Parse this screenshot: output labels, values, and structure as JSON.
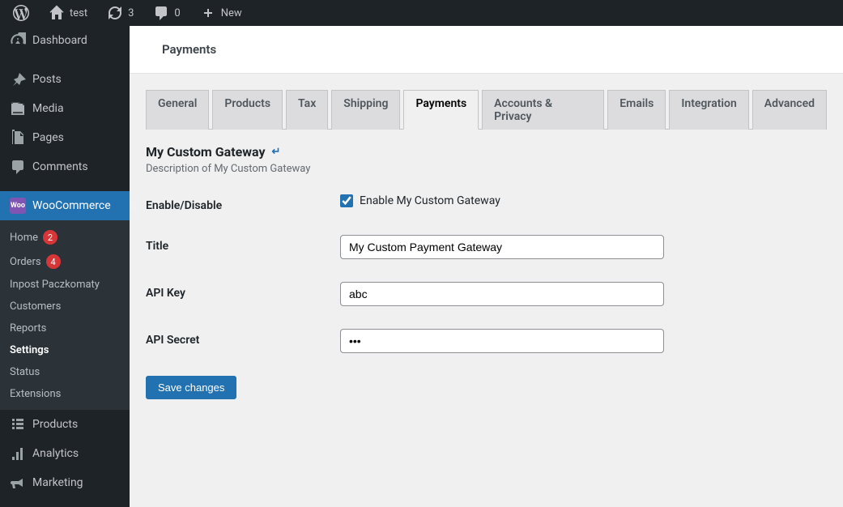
{
  "toolbar": {
    "site_name": "test",
    "updates": "3",
    "comments": "0",
    "new_label": "New"
  },
  "sidebar": {
    "items": [
      {
        "label": "Dashboard"
      },
      {
        "label": "Posts"
      },
      {
        "label": "Media"
      },
      {
        "label": "Pages"
      },
      {
        "label": "Comments"
      },
      {
        "label": "WooCommerce"
      },
      {
        "label": "Products"
      },
      {
        "label": "Analytics"
      },
      {
        "label": "Marketing"
      }
    ],
    "woo_submenu": [
      {
        "label": "Home",
        "badge": "2"
      },
      {
        "label": "Orders",
        "badge": "4"
      },
      {
        "label": "Inpost Paczkomaty"
      },
      {
        "label": "Customers"
      },
      {
        "label": "Reports"
      },
      {
        "label": "Settings",
        "current": true
      },
      {
        "label": "Status"
      },
      {
        "label": "Extensions"
      }
    ]
  },
  "page": {
    "header": "Payments",
    "tabs": [
      "General",
      "Products",
      "Tax",
      "Shipping",
      "Payments",
      "Accounts & Privacy",
      "Emails",
      "Integration",
      "Advanced"
    ],
    "active_tab": "Payments",
    "section_title": "My Custom Gateway",
    "section_desc": "Description of My Custom Gateway",
    "fields": {
      "enable": {
        "label": "Enable/Disable",
        "checkbox_label": "Enable My Custom Gateway",
        "checked": true
      },
      "title": {
        "label": "Title",
        "value": "My Custom Payment Gateway"
      },
      "api_key": {
        "label": "API Key",
        "value": "abc"
      },
      "api_secret": {
        "label": "API Secret",
        "value": "•••"
      }
    },
    "save_label": "Save changes"
  }
}
